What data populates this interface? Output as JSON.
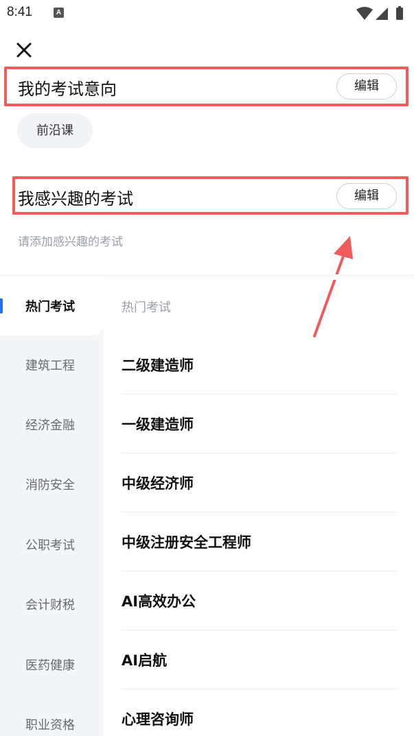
{
  "status_bar": {
    "time": "8:41",
    "notification_icon": "A"
  },
  "header": {
    "close_icon": "close-icon"
  },
  "intent_section": {
    "title": "我的考试意向",
    "edit_label": "编辑",
    "tags": [
      "前沿课"
    ]
  },
  "interest_section": {
    "title": "我感兴趣的考试",
    "edit_label": "编辑",
    "hint": "请添加感兴趣的考试"
  },
  "categories": [
    {
      "label": "热门考试",
      "active": true
    },
    {
      "label": "建筑工程",
      "active": false
    },
    {
      "label": "经济金融",
      "active": false
    },
    {
      "label": "消防安全",
      "active": false
    },
    {
      "label": "公职考试",
      "active": false
    },
    {
      "label": "会计财税",
      "active": false
    },
    {
      "label": "医药健康",
      "active": false
    },
    {
      "label": "职业资格",
      "active": false
    }
  ],
  "content": {
    "heading": "热门考试",
    "exams": [
      "二级建造师",
      "一级建造师",
      "中级经济师",
      "中级注册安全工程师",
      "AI高效办公",
      "AI启航",
      "心理咨询师"
    ]
  },
  "colors": {
    "highlight": "#f15a5a",
    "accent": "#2a6df4",
    "sidebar_bg": "#f4f5f7"
  }
}
